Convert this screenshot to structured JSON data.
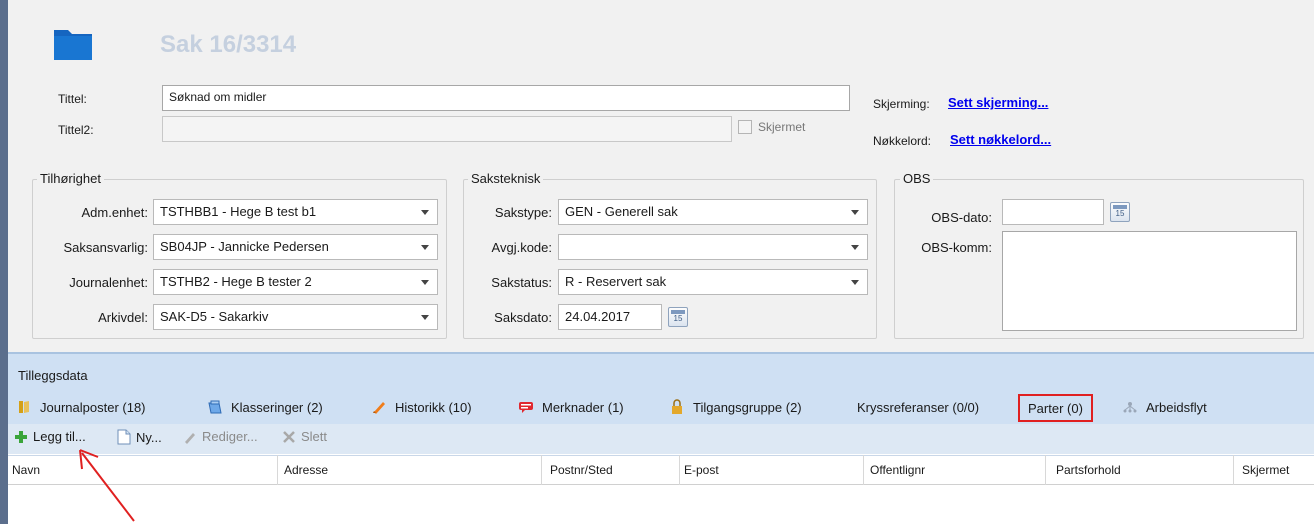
{
  "header": {
    "case_title": "Sak 16/3314",
    "tittel_label": "Tittel:",
    "tittel_value": "Søknad om midler",
    "tittel2_label": "Tittel2:",
    "tittel2_value": "",
    "skjermet_label": "Skjermet",
    "skjerming_label": "Skjerming:",
    "skjerming_link": "Sett skjerming...",
    "nokkelord_label": "Nøkkelord:",
    "nokkelord_link": "Sett nøkkelord..."
  },
  "tilhorighet": {
    "title": "Tilhørighet",
    "fields": [
      {
        "label": "Adm.enhet:",
        "value": "TSTHBB1 - Hege B test b1"
      },
      {
        "label": "Saksansvarlig:",
        "value": "SB04JP - Jannicke Pedersen"
      },
      {
        "label": "Journalenhet:",
        "value": "TSTHB2 - Hege B tester 2"
      },
      {
        "label": "Arkivdel:",
        "value": "SAK-D5 - Sakarkiv"
      }
    ]
  },
  "saksteknisk": {
    "title": "Saksteknisk",
    "fields": [
      {
        "label": "Sakstype:",
        "value": "GEN - Generell sak"
      },
      {
        "label": "Avgj.kode:",
        "value": ""
      },
      {
        "label": "Sakstatus:",
        "value": "R - Reservert sak"
      },
      {
        "label": "Saksdato:",
        "value": "24.04.2017"
      }
    ],
    "calendar_day": "15"
  },
  "obs": {
    "title": "OBS",
    "dato_label": "OBS-dato:",
    "dato_value": "",
    "komm_label": "OBS-komm:",
    "komm_value": "",
    "calendar_day": "15"
  },
  "tilleggsdata": {
    "title": "Tilleggsdata",
    "tabs": [
      {
        "label": "Journalposter (18)",
        "icon": "journal-icon"
      },
      {
        "label": "Klasseringer (2)",
        "icon": "classification-icon"
      },
      {
        "label": "Historikk (10)",
        "icon": "history-icon"
      },
      {
        "label": "Merknader (1)",
        "icon": "comment-icon"
      },
      {
        "label": "Tilgangsgruppe (2)",
        "icon": "lock-icon"
      },
      {
        "label": "Kryssreferanser (0/0)",
        "icon": ""
      },
      {
        "label": "Parter (0)",
        "icon": ""
      },
      {
        "label": "Arbeidsflyt",
        "icon": "workflow-icon"
      }
    ],
    "active_tab": "Parter (0)"
  },
  "toolbar": {
    "add_label": "Legg til...",
    "new_label": "Ny...",
    "edit_label": "Rediger...",
    "delete_label": "Slett"
  },
  "grid": {
    "columns": [
      "Navn",
      "Adresse",
      "Postnr/Sted",
      "E-post",
      "Offentlignr",
      "Partsforhold",
      "Skjermet"
    ]
  },
  "colors": {
    "highlight_box": "#e02020",
    "annotation_arrow": "#e02020",
    "link": "#0000ee"
  }
}
